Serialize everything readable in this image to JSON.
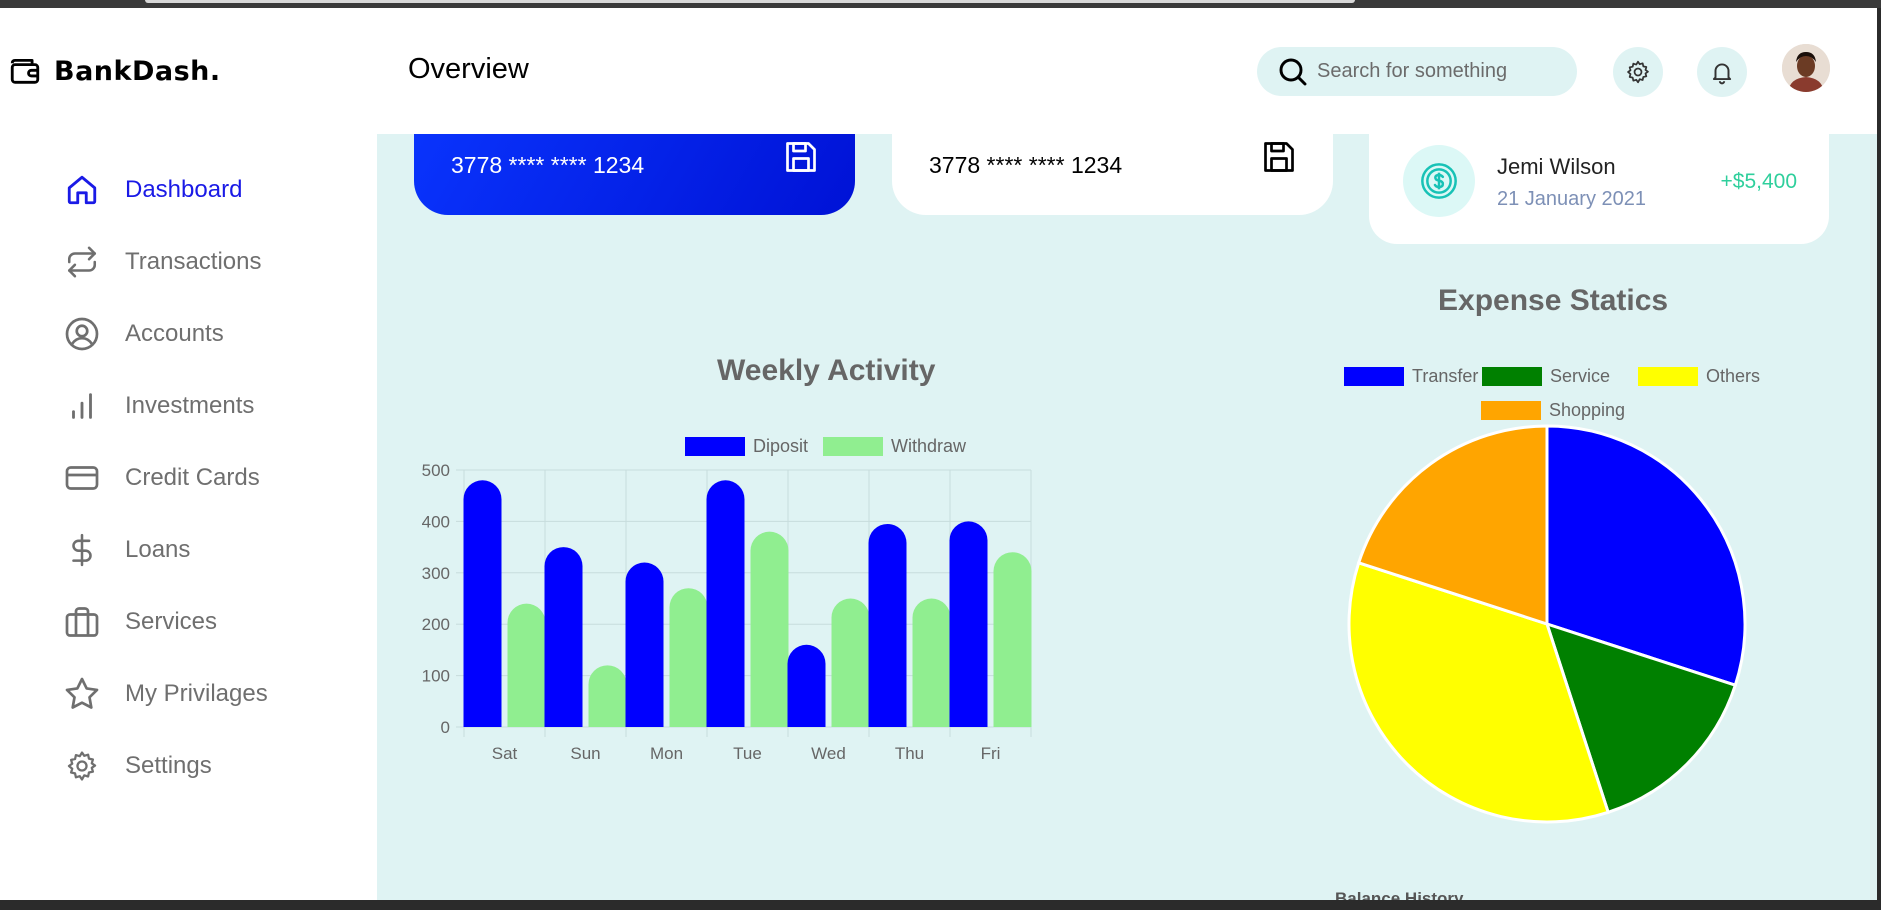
{
  "app": {
    "name": "BankDash."
  },
  "header": {
    "title": "Overview",
    "search_placeholder": "Search for something"
  },
  "sidebar": {
    "items": [
      {
        "label": "Dashboard",
        "icon": "home-icon",
        "active": true
      },
      {
        "label": "Transactions",
        "icon": "transfer-icon",
        "active": false
      },
      {
        "label": "Accounts",
        "icon": "user-circle-icon",
        "active": false
      },
      {
        "label": "Investments",
        "icon": "bar-chart-icon",
        "active": false
      },
      {
        "label": "Credit Cards",
        "icon": "credit-card-icon",
        "active": false
      },
      {
        "label": "Loans",
        "icon": "dollar-icon",
        "active": false
      },
      {
        "label": "Services",
        "icon": "briefcase-icon",
        "active": false
      },
      {
        "label": "My Privilages",
        "icon": "star-icon",
        "active": false
      },
      {
        "label": "Settings",
        "icon": "gear-icon",
        "active": false
      }
    ]
  },
  "cards": [
    {
      "number": "3778 **** **** 1234",
      "style": "blue"
    },
    {
      "number": "3778 **** **** 1234",
      "style": "white"
    }
  ],
  "transaction": {
    "name": "Jemi Wilson",
    "date": "21 January 2021",
    "amount": "+$5,400",
    "amount_color": "#2fcf9c"
  },
  "balance_history": {
    "title": "Balance History"
  },
  "colors": {
    "accent": "#1a1ae6",
    "main_bg": "#dff3f3",
    "diposit": "#0000ff",
    "withdraw": "#90ee90",
    "transfer": "#0000ff",
    "service": "#008000",
    "others": "#ffff00",
    "shopping": "#ffa500"
  },
  "chart_data": [
    {
      "type": "bar",
      "title": "Weekly Activity",
      "categories": [
        "Sat",
        "Sun",
        "Mon",
        "Tue",
        "Wed",
        "Thu",
        "Fri"
      ],
      "series": [
        {
          "name": "Diposit",
          "color": "#0000ff",
          "values": [
            480,
            350,
            320,
            480,
            160,
            395,
            400
          ]
        },
        {
          "name": "Withdraw",
          "color": "#90ee90",
          "values": [
            240,
            120,
            270,
            380,
            250,
            250,
            340
          ]
        }
      ],
      "ylim": [
        0,
        500
      ],
      "yticks": [
        "0",
        "100",
        "200",
        "300",
        "400",
        "500"
      ],
      "grid": true,
      "legend": "top-center"
    },
    {
      "type": "pie",
      "title": "Expense Statics",
      "labels": [
        "Transfer",
        "Service",
        "Others",
        "Shopping"
      ],
      "colors": [
        "#0000ff",
        "#008000",
        "#ffff00",
        "#ffa500"
      ],
      "values": [
        30,
        15,
        35,
        20
      ],
      "legend": "top-center"
    }
  ]
}
